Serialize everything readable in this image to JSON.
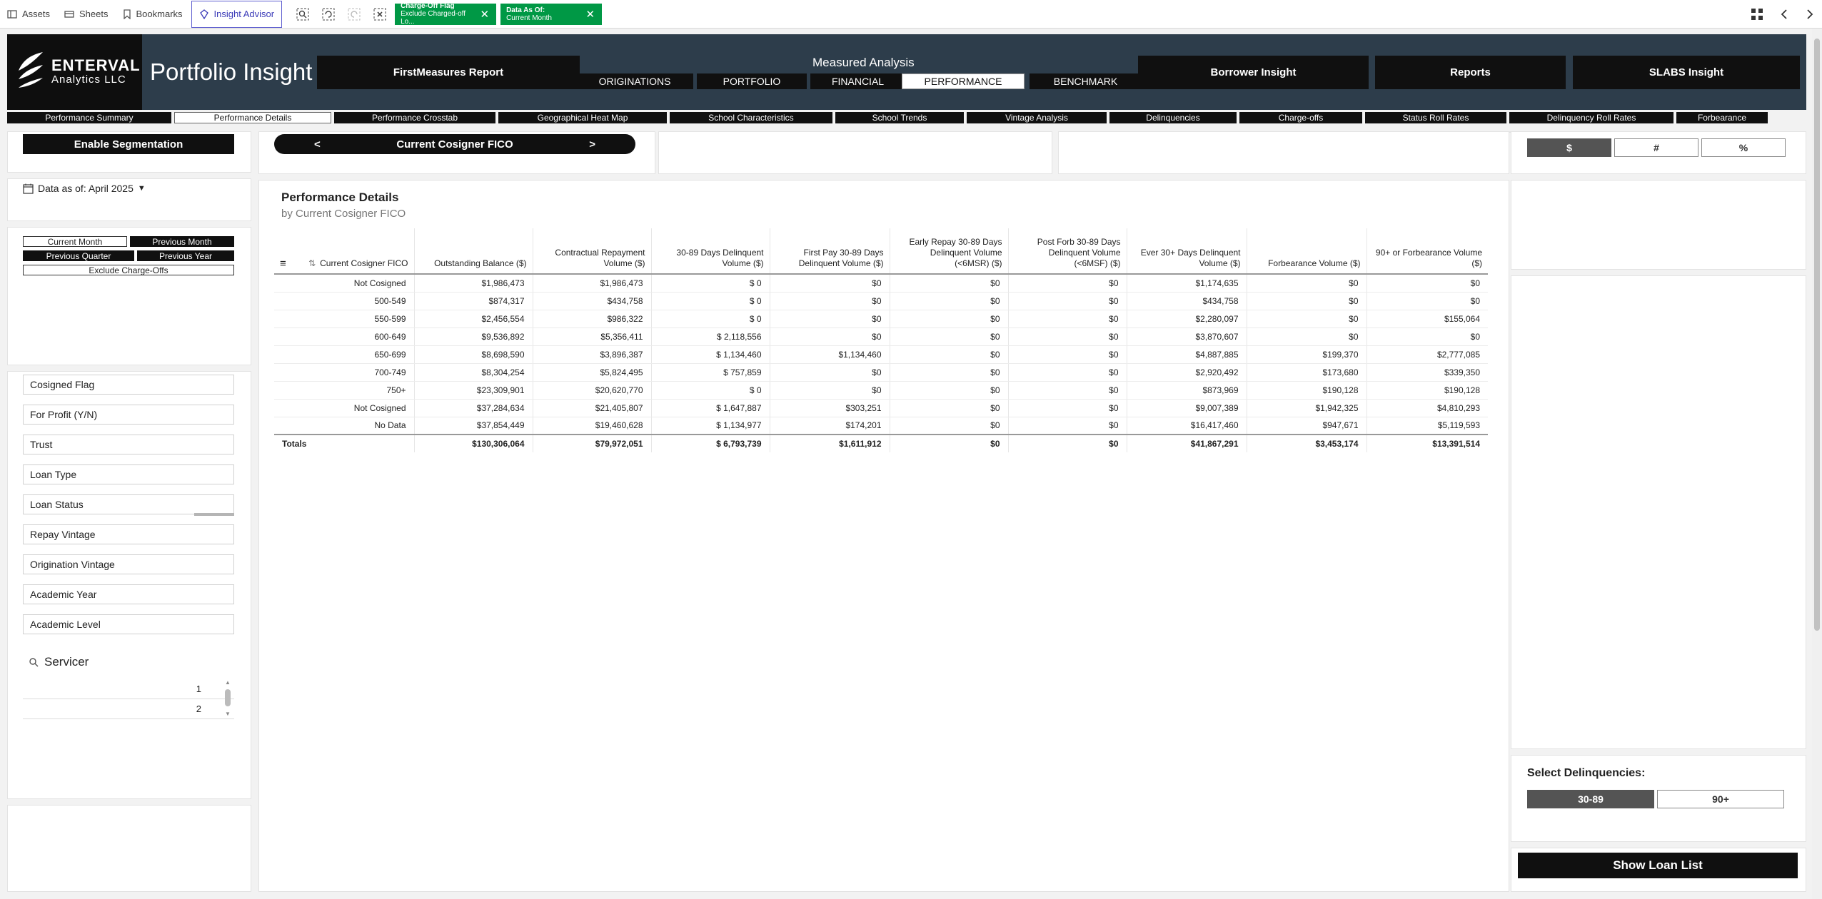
{
  "toolbar": {
    "assets": "Assets",
    "sheets": "Sheets",
    "bookmarks": "Bookmarks",
    "insight_advisor": "Insight Advisor"
  },
  "selections": [
    {
      "title": "Charge-Off Flag",
      "value": "Exclude Charged-off Lo..."
    },
    {
      "title": "Data As Of:",
      "value": "Current Month"
    }
  ],
  "header": {
    "logo_name": "ENTERVAL",
    "logo_sub": "Analytics LLC",
    "app_title": "Portfolio Insight",
    "firstmeasures": "FirstMeasures Report",
    "measured_title": "Measured Analysis",
    "measured_tabs": [
      "ORIGINATIONS",
      "PORTFOLIO",
      "FINANCIAL",
      "PERFORMANCE",
      "BENCHMARK"
    ],
    "borrower": "Borrower Insight",
    "reports": "Reports",
    "slabs": "SLABS Insight"
  },
  "subtabs": [
    "Performance Summary",
    "Performance Details",
    "Performance Crosstab",
    "Geographical Heat Map",
    "School Characteristics",
    "School Trends",
    "Vintage Analysis",
    "Delinquencies",
    "Charge-offs",
    "Status Roll Rates",
    "Delinquency Roll Rates",
    "Forbearance"
  ],
  "left": {
    "enable_segmentation": "Enable Segmentation",
    "data_as_of": "Data as of: April 2025",
    "periods": {
      "current_month": "Current Month",
      "previous_month": "Previous Month",
      "previous_quarter": "Previous Quarter",
      "previous_year": "Previous Year",
      "exclude_chargeoffs": "Exclude Charge-Offs"
    },
    "filters": [
      "Cosigned Flag",
      "For Profit (Y/N)",
      "Trust",
      "Loan Type",
      "Loan Status",
      "Repay Vintage",
      "Origination Vintage",
      "Academic Year",
      "Academic Level"
    ],
    "servicer_label": "Servicer",
    "servicer_values": [
      "1",
      "2"
    ]
  },
  "dimension_nav": {
    "prev": "<",
    "label": "Current Cosigner FICO",
    "next": ">"
  },
  "table": {
    "title": "Performance Details",
    "subtitle": "by Current Cosigner FICO",
    "columns": [
      "Current Cosigner FICO",
      "Outstanding Balance ($)",
      "Contractual Repayment Volume ($)",
      "30-89 Days Delinquent Volume ($)",
      "First Pay 30-89 Days Delinquent Volume ($)",
      "Early Repay 30-89 Days Delinquent Volume (<6MSR) ($)",
      "Post Forb 30-89 Days Delinquent Volume (<6MSF) ($)",
      "Ever 30+ Days Delinquent Volume ($)",
      "Forbearance Volume ($)",
      "90+ or Forbearance Volume ($)"
    ],
    "rows": [
      [
        "Not Cosigned",
        "$1,986,473",
        "$1,986,473",
        "$ 0",
        "$0",
        "$0",
        "$0",
        "$1,174,635",
        "$0",
        "$0"
      ],
      [
        "500-549",
        "$874,317",
        "$434,758",
        "$ 0",
        "$0",
        "$0",
        "$0",
        "$434,758",
        "$0",
        "$0"
      ],
      [
        "550-599",
        "$2,456,554",
        "$986,322",
        "$ 0",
        "$0",
        "$0",
        "$0",
        "$2,280,097",
        "$0",
        "$155,064"
      ],
      [
        "600-649",
        "$9,536,892",
        "$5,356,411",
        "$ 2,118,556",
        "$0",
        "$0",
        "$0",
        "$3,870,607",
        "$0",
        "$0"
      ],
      [
        "650-699",
        "$8,698,590",
        "$3,896,387",
        "$ 1,134,460",
        "$1,134,460",
        "$0",
        "$0",
        "$4,887,885",
        "$199,370",
        "$2,777,085"
      ],
      [
        "700-749",
        "$8,304,254",
        "$5,824,495",
        "$ 757,859",
        "$0",
        "$0",
        "$0",
        "$2,920,492",
        "$173,680",
        "$339,350"
      ],
      [
        "750+",
        "$23,309,901",
        "$20,620,770",
        "$ 0",
        "$0",
        "$0",
        "$0",
        "$873,969",
        "$190,128",
        "$190,128"
      ],
      [
        "Not Cosigned",
        "$37,284,634",
        "$21,405,807",
        "$ 1,647,887",
        "$303,251",
        "$0",
        "$0",
        "$9,007,389",
        "$1,942,325",
        "$4,810,293"
      ],
      [
        "No Data",
        "$37,854,449",
        "$19,460,628",
        "$ 1,134,977",
        "$174,201",
        "$0",
        "$0",
        "$16,417,460",
        "$947,671",
        "$5,119,593"
      ]
    ],
    "totals": [
      "Totals",
      "$130,306,064",
      "$79,972,051",
      "$ 6,793,739",
      "$1,611,912",
      "$0",
      "$0",
      "$41,867,291",
      "$3,453,174",
      "$13,391,514"
    ]
  },
  "right": {
    "units": [
      "$",
      "#",
      "%"
    ],
    "select_delinquencies": "Select Delinquencies:",
    "delinquency_options": [
      "30-89",
      "90+"
    ],
    "show_loan_list": "Show Loan List"
  },
  "colors": {
    "header_bg": "#2d3d4b",
    "chip_green": "#009845",
    "dark_button": "#101010",
    "selected_gray": "#545454"
  }
}
